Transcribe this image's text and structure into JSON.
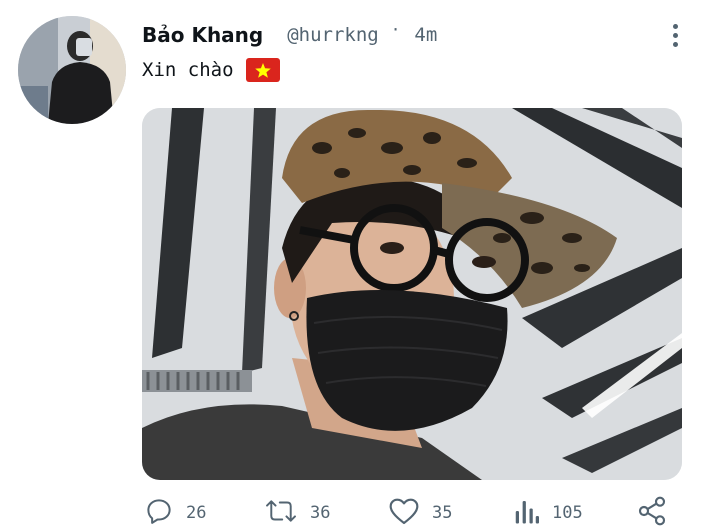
{
  "tweet": {
    "author_name": "Bảo Khang",
    "handle": "@hurrkng",
    "separator": "·",
    "time": "4m",
    "text": "Xin chào",
    "flag_icon": "vietnam-flag-icon",
    "colors": {
      "text": "#0f1419",
      "muted": "#536471",
      "flag_red": "#da251d",
      "flag_star": "#ffff00"
    }
  },
  "actions": {
    "reply": {
      "icon": "reply-icon",
      "count": "26"
    },
    "retweet": {
      "icon": "retweet-icon",
      "count": "36"
    },
    "like": {
      "icon": "heart-icon",
      "count": "35"
    },
    "views": {
      "icon": "views-icon",
      "count": "105"
    },
    "share": {
      "icon": "share-icon"
    }
  }
}
